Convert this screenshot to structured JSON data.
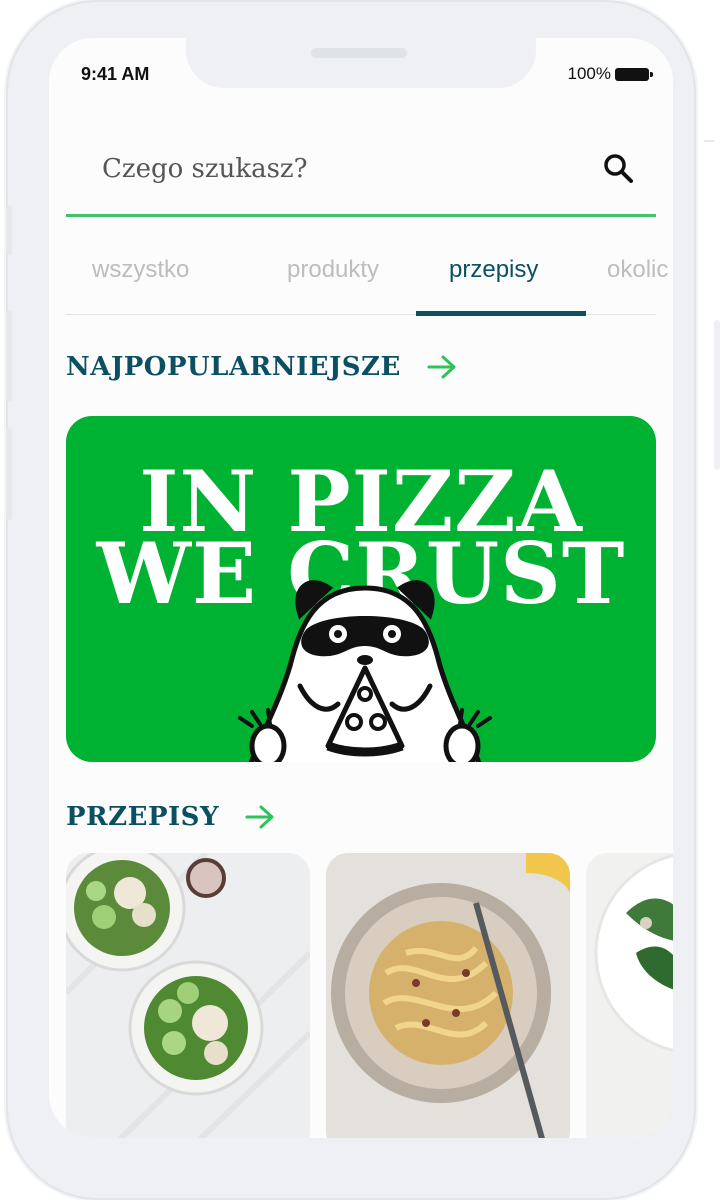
{
  "status": {
    "time": "9:41 AM",
    "battery": "100%"
  },
  "search": {
    "placeholder": "Czego szukasz?"
  },
  "tabs": [
    {
      "label": "wszystko",
      "active": false
    },
    {
      "label": "produkty",
      "active": false
    },
    {
      "label": "przepisy",
      "active": true
    },
    {
      "label": "okolic",
      "active": false
    }
  ],
  "popular": {
    "title": "NAJPOPULARNIEJSZE"
  },
  "banner": {
    "line1": "IN PIZZA",
    "line2": "WE CRUST"
  },
  "recipes": {
    "title": "PRZEPISY"
  },
  "colors": {
    "accent": "#3ec46d",
    "brand": "#0b4f63",
    "banner": "#00b232"
  },
  "icons": [
    "search-icon",
    "arrow-right-icon",
    "battery-icon",
    "raccoon-pizza-icon"
  ]
}
